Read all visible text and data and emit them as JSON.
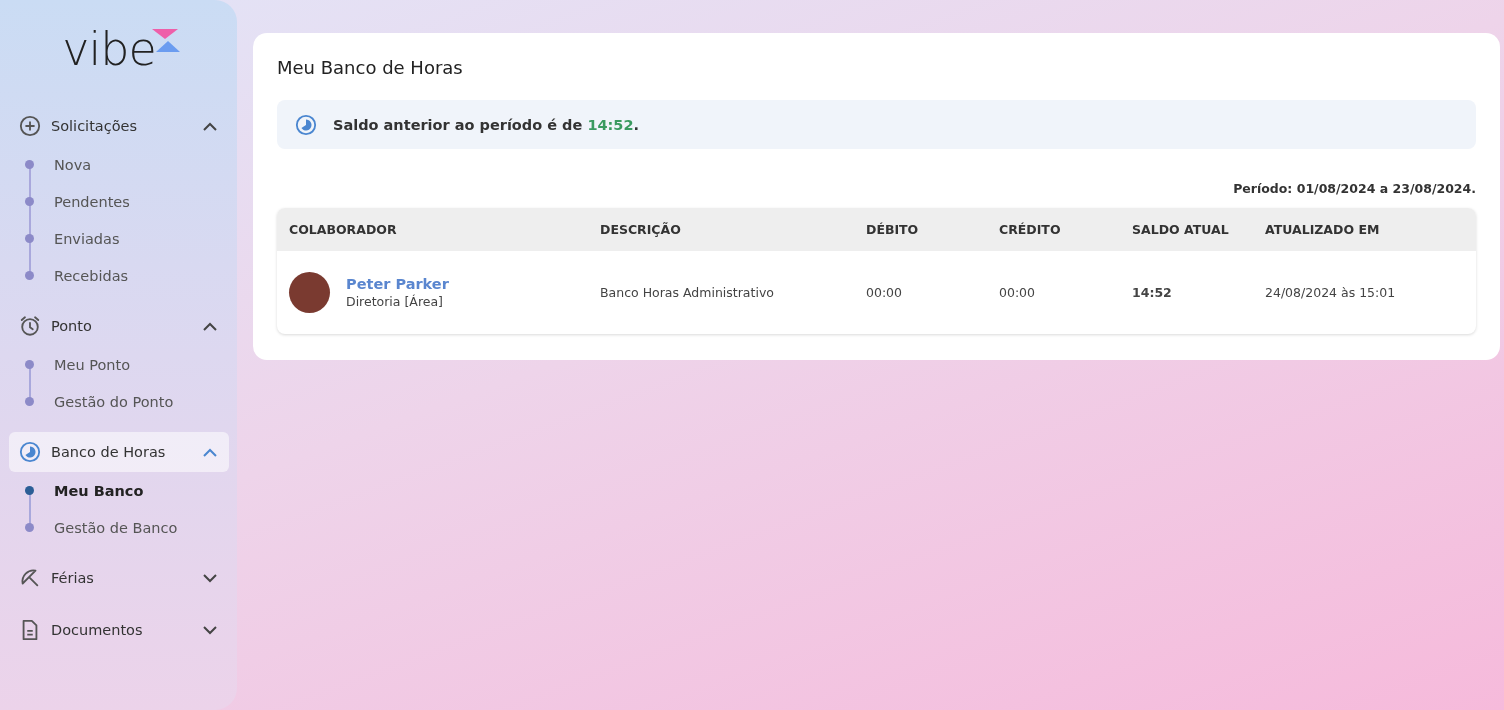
{
  "logo": {
    "text": "vibe"
  },
  "sidebar": {
    "groups": [
      {
        "label": "Solicitações",
        "expanded": true,
        "selected": false,
        "items": [
          {
            "label": "Nova",
            "selected": false
          },
          {
            "label": "Pendentes",
            "selected": false
          },
          {
            "label": "Enviadas",
            "selected": false
          },
          {
            "label": "Recebidas",
            "selected": false
          }
        ]
      },
      {
        "label": "Ponto",
        "expanded": true,
        "selected": false,
        "items": [
          {
            "label": "Meu Ponto",
            "selected": false
          },
          {
            "label": "Gestão do Ponto",
            "selected": false
          }
        ]
      },
      {
        "label": "Banco de Horas",
        "expanded": true,
        "selected": true,
        "items": [
          {
            "label": "Meu Banco",
            "selected": true
          },
          {
            "label": "Gestão de Banco",
            "selected": false
          }
        ]
      },
      {
        "label": "Férias",
        "expanded": false,
        "selected": false
      },
      {
        "label": "Documentos",
        "expanded": false,
        "selected": false
      }
    ]
  },
  "page": {
    "title": "Meu Banco de Horas",
    "banner": {
      "prefix": "Saldo anterior ao período é de ",
      "value": "14:52",
      "suffix": "."
    },
    "period": "Período: 01/08/2024 a 23/08/2024."
  },
  "table": {
    "columns": [
      "COLABORADOR",
      "DESCRIÇÃO",
      "DÉBITO",
      "CRÉDITO",
      "SALDO ATUAL",
      "ATUALIZADO EM"
    ],
    "rows": [
      {
        "name": "Peter Parker",
        "area": "Diretoria [Área]",
        "description": "Banco Horas Administrativo",
        "debit": "00:00",
        "credit": "00:00",
        "balance": "14:52",
        "updated": "24/08/2024 às 15:01"
      }
    ]
  }
}
